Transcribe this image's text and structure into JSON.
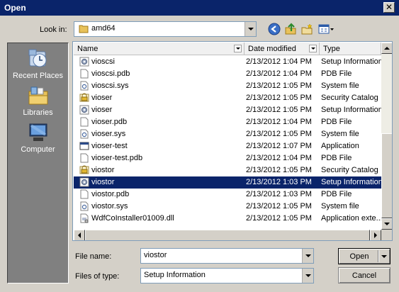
{
  "window": {
    "title": "Open",
    "close_glyph": "✕"
  },
  "toolbar": {
    "look_in_label": "Look in:",
    "look_in_value": "amd64",
    "back_icon": "back-icon",
    "up_icon": "up-folder-icon",
    "new_folder_icon": "new-folder-icon",
    "views_icon": "views-menu-icon"
  },
  "places": [
    {
      "label": "Recent Places",
      "icon": "recent-places-icon"
    },
    {
      "label": "Libraries",
      "icon": "libraries-icon"
    },
    {
      "label": "Computer",
      "icon": "computer-icon"
    }
  ],
  "columns": {
    "name": "Name",
    "date": "Date modified",
    "type": "Type"
  },
  "files": [
    {
      "name": "vioscsi",
      "date": "2/13/2012 1:04 PM",
      "type": "Setup Information",
      "icon": "inf"
    },
    {
      "name": "vioscsi.pdb",
      "date": "2/13/2012 1:04 PM",
      "type": "PDB File",
      "icon": "file"
    },
    {
      "name": "vioscsi.sys",
      "date": "2/13/2012 1:05 PM",
      "type": "System file",
      "icon": "sys"
    },
    {
      "name": "vioser",
      "date": "2/13/2012 1:05 PM",
      "type": "Security Catalog",
      "icon": "cat"
    },
    {
      "name": "vioser",
      "date": "2/13/2012 1:05 PM",
      "type": "Setup Information",
      "icon": "inf"
    },
    {
      "name": "vioser.pdb",
      "date": "2/13/2012 1:04 PM",
      "type": "PDB File",
      "icon": "file"
    },
    {
      "name": "vioser.sys",
      "date": "2/13/2012 1:05 PM",
      "type": "System file",
      "icon": "sys"
    },
    {
      "name": "vioser-test",
      "date": "2/13/2012 1:07 PM",
      "type": "Application",
      "icon": "exe"
    },
    {
      "name": "vioser-test.pdb",
      "date": "2/13/2012 1:04 PM",
      "type": "PDB File",
      "icon": "file"
    },
    {
      "name": "viostor",
      "date": "2/13/2012 1:05 PM",
      "type": "Security Catalog",
      "icon": "cat"
    },
    {
      "name": "viostor",
      "date": "2/13/2012 1:03 PM",
      "type": "Setup Information",
      "icon": "inf",
      "selected": true
    },
    {
      "name": "viostor.pdb",
      "date": "2/13/2012 1:03 PM",
      "type": "PDB File",
      "icon": "file"
    },
    {
      "name": "viostor.sys",
      "date": "2/13/2012 1:05 PM",
      "type": "System file",
      "icon": "sys"
    },
    {
      "name": "WdfCoInstaller01009.dll",
      "date": "2/13/2012 1:05 PM",
      "type": "Application exte...",
      "icon": "dll"
    }
  ],
  "form": {
    "file_name_label": "File name:",
    "file_name_value": "viostor",
    "file_type_label": "Files of type:",
    "file_type_value": "Setup Information",
    "open_label": "Open",
    "cancel_label": "Cancel"
  },
  "colors": {
    "titlebar": "#0a246a",
    "selection": "#0a246a",
    "dialog_bg": "#d4d0c8",
    "places_bg": "#808080"
  }
}
